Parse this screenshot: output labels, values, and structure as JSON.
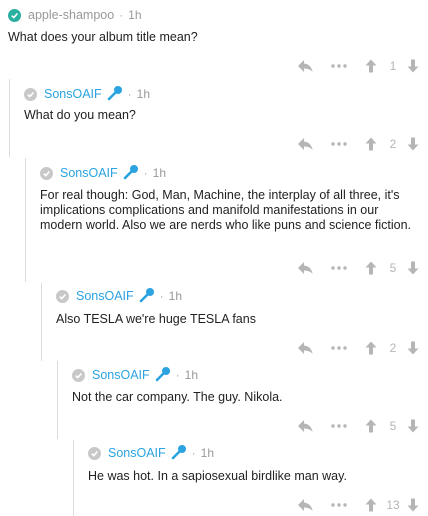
{
  "colors": {
    "accent": "#2aa3e0",
    "verified": "#2ab0a0",
    "muted": "#999999"
  },
  "comments": [
    {
      "user": "apple-shampoo",
      "time": "1h",
      "text": "What does your album title mean?",
      "score": "1",
      "badge": "check",
      "mic": false
    },
    {
      "user": "SonsOAIF",
      "time": "1h",
      "text": "What do you mean?",
      "score": "2",
      "badge": "grey",
      "mic": true
    },
    {
      "user": "SonsOAIF",
      "time": "1h",
      "text": "For real though: God, Man, Machine, the interplay of all three, it's implications complications and manifold manifestations in our modern world. Also we are nerds who like puns and science fiction.",
      "score": "5",
      "badge": "grey",
      "mic": true
    },
    {
      "user": "SonsOAIF",
      "time": "1h",
      "text": "Also TESLA we're huge TESLA fans",
      "score": "2",
      "badge": "grey",
      "mic": true
    },
    {
      "user": "SonsOAIF",
      "time": "1h",
      "text": "Not the car company. The guy. Nikola.",
      "score": "5",
      "badge": "grey",
      "mic": true
    },
    {
      "user": "SonsOAIF",
      "time": "1h",
      "text": "He was hot. In a sapiosexual birdlike man way.",
      "score": "13",
      "badge": "grey",
      "mic": true
    }
  ]
}
